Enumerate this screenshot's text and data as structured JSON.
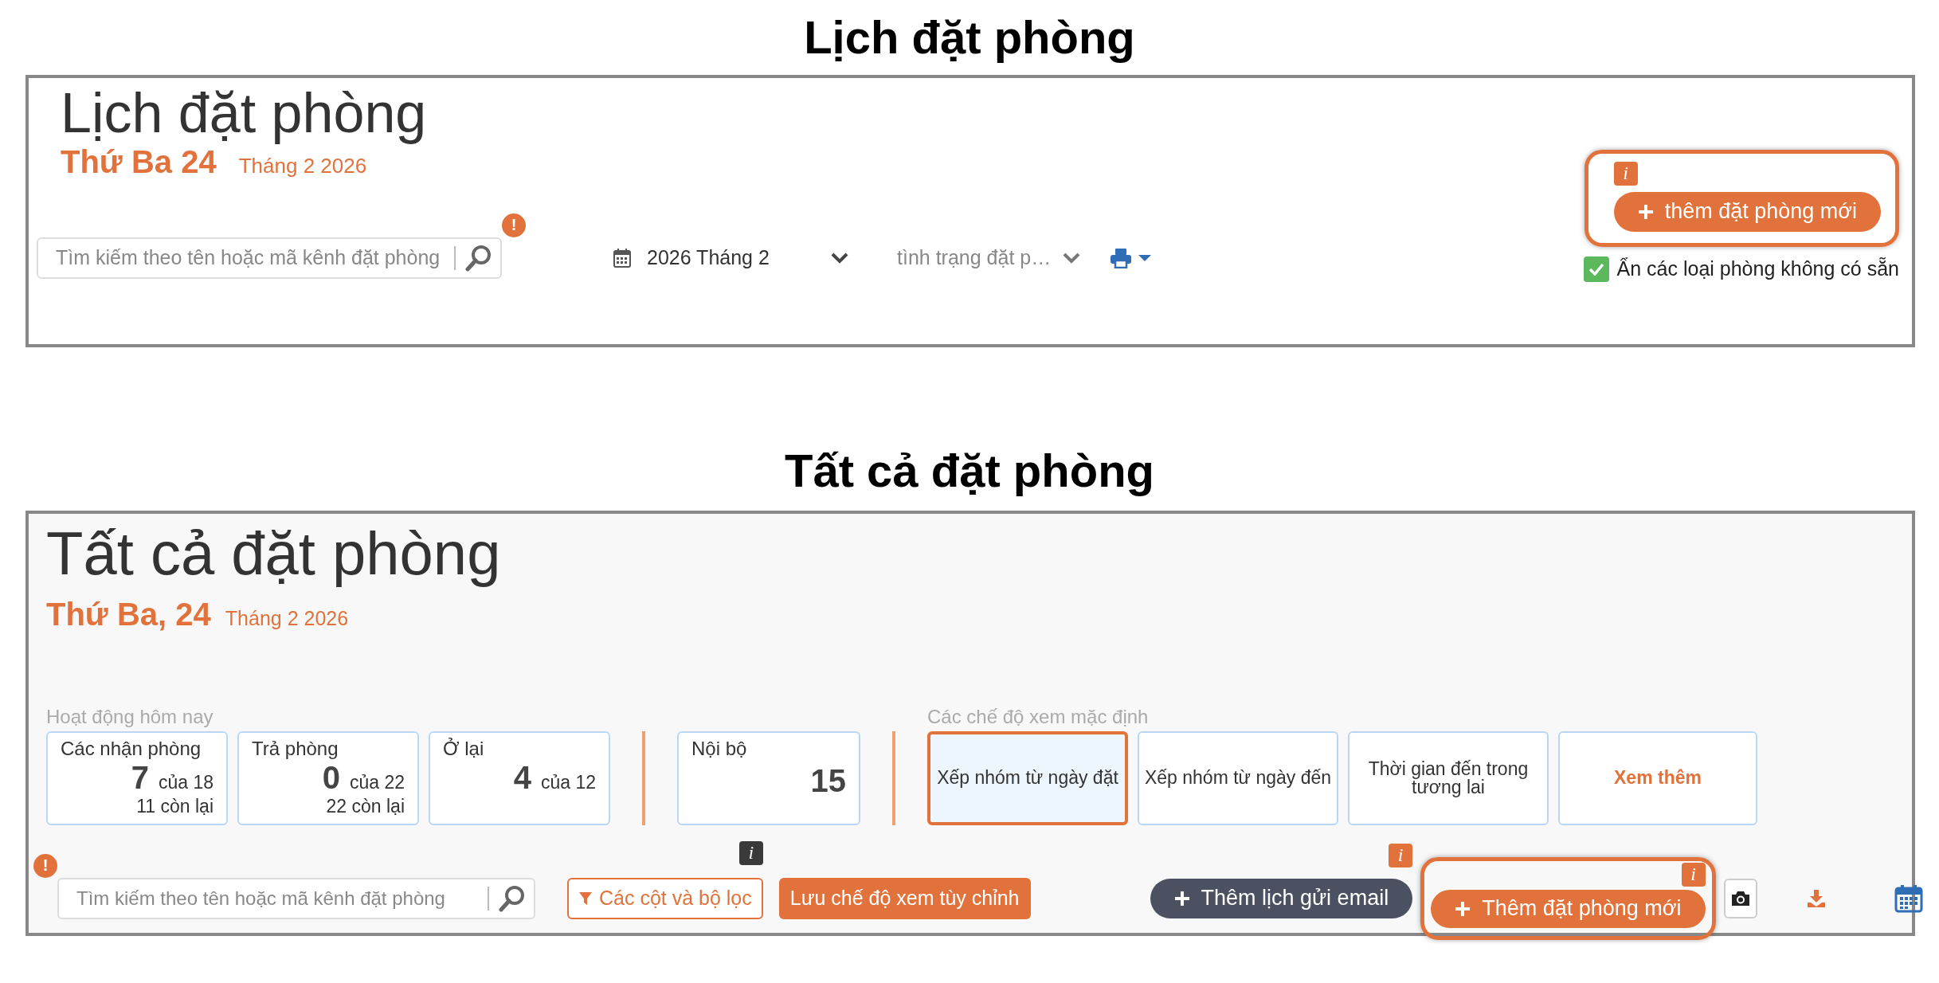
{
  "calendar_view": {
    "heading": "Lịch đặt phòng",
    "title": "Lịch đặt phòng",
    "day": "Thứ Ba 24",
    "month": "Tháng 2 2026",
    "search": {
      "placeholder": "Tìm kiếm theo tên hoặc mã kênh đặt phòng",
      "alert_badge": "!"
    },
    "date_picker": {
      "value": "2026 Tháng 2"
    },
    "status_filter": {
      "value": "tình trạng đặt p…"
    },
    "add_button": {
      "label": "thêm đặt phòng mới",
      "info_badge": "i",
      "highlighted": true
    },
    "hide_unavailable": {
      "label": "Ẩn các loại phòng không có sẵn",
      "checked": true
    }
  },
  "all_bookings_view": {
    "heading": "Tất cả đặt phòng",
    "title": "Tất cả đặt phòng",
    "day": "Thứ Ba, 24",
    "month": "Tháng 2 2026",
    "activity_label": "Hoạt động hôm nay",
    "activities": [
      {
        "label": "Các nhận phòng",
        "count": "7",
        "of": "của 18",
        "remaining": "11 còn lại"
      },
      {
        "label": "Trả phòng",
        "count": "0",
        "of": "của 22",
        "remaining": "22 còn lại"
      },
      {
        "label": "Ở lại",
        "count": "4",
        "of": "của 12"
      }
    ],
    "internal": {
      "label": "Nội bộ",
      "count": "15"
    },
    "views_label": "Các chế độ xem mặc định",
    "views": [
      {
        "label": "Xếp nhóm từ ngày đặt",
        "kind": "view",
        "selected": true
      },
      {
        "label": "Xếp nhóm từ ngày đến",
        "kind": "view",
        "selected": false
      },
      {
        "label": "Thời gian đến trong tương lai",
        "kind": "view",
        "selected": false
      },
      {
        "label": "Xem thêm",
        "kind": "more",
        "selected": false
      }
    ],
    "search": {
      "placeholder": "Tìm kiếm theo tên hoặc mã kênh đặt phòng",
      "alert_badge": "!"
    },
    "columns_button": {
      "label": "Các cột và bộ lọc",
      "info_badge": "i"
    },
    "save_view_button": {
      "label": "Lưu chế độ xem tùy chỉnh"
    },
    "email_button": {
      "label": "Thêm lịch gửi email",
      "info_badge": "i"
    },
    "add_button": {
      "label": "Thêm đặt phòng mới",
      "info_badge": "i",
      "highlighted": true
    }
  }
}
